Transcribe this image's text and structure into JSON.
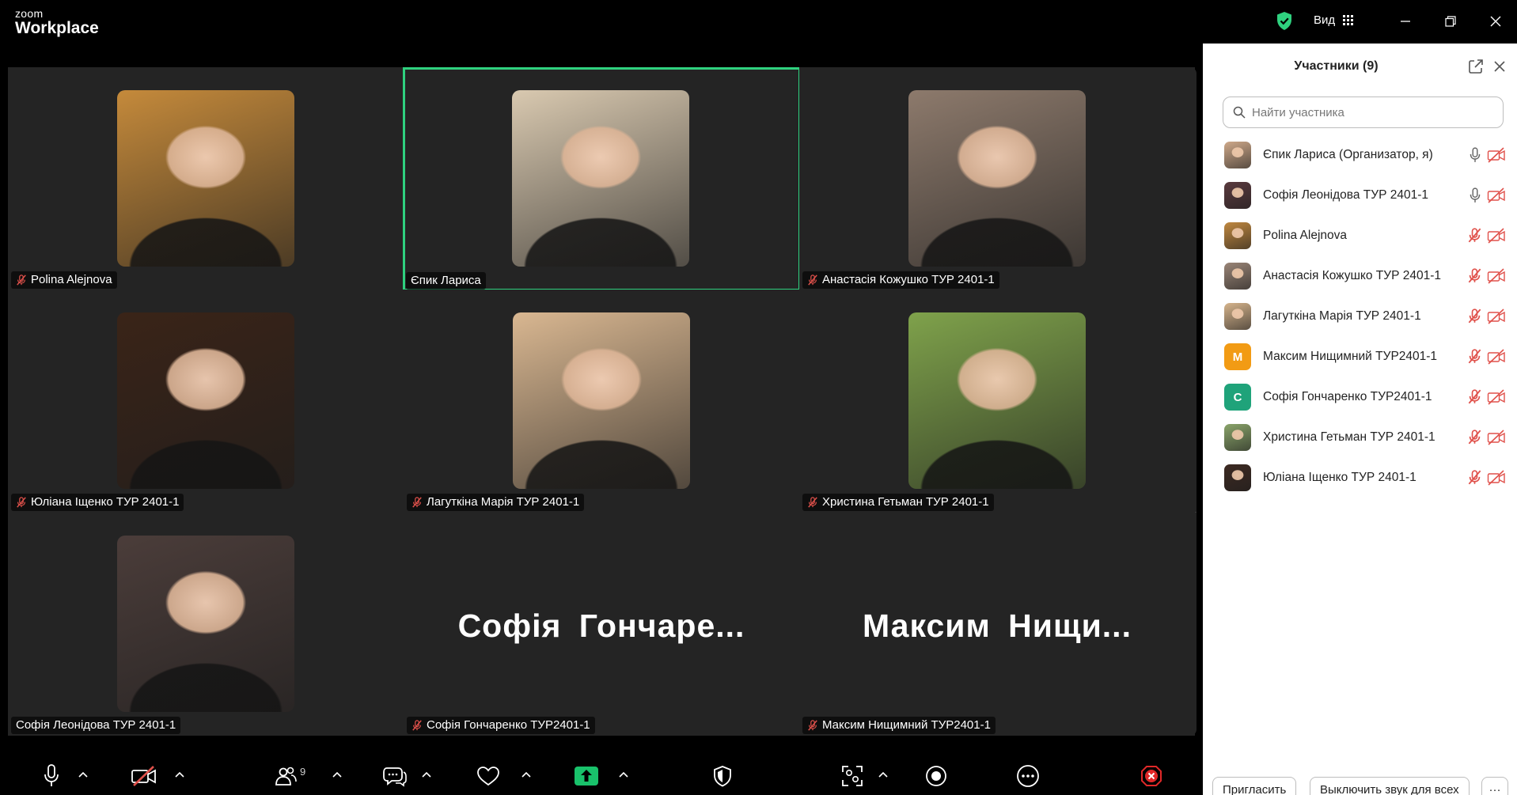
{
  "window": {
    "logo_small": "zoom",
    "logo_big": "Workplace",
    "view_label": "Вид"
  },
  "tiles": [
    {
      "name": "Polina Alejnova",
      "muted": true,
      "bg": "#c58a3b"
    },
    {
      "name": "Єпик Лариса",
      "muted": false,
      "active": true,
      "bg": "#d9c9b0"
    },
    {
      "name": "Анастасія Кожушко ТУР 2401-1",
      "muted": true,
      "bg": "#8d7a6c"
    },
    {
      "name": "Юліана Іщенко ТУР 2401-1",
      "muted": true,
      "bg": "#3a2418"
    },
    {
      "name": "Лагуткіна Марія ТУР 2401-1",
      "muted": true,
      "bg": "#d9b791"
    },
    {
      "name": "Христина Гетьман ТУР 2401-1",
      "muted": true,
      "bg": "#7fa24b"
    },
    {
      "name": "Софія Леонідова ТУР 2401-1",
      "muted": false,
      "bg": "#4b3d3a"
    },
    {
      "name": "Софія Гончаренко ТУР2401-1",
      "muted": true,
      "big_name": "Софія  Гончаре..."
    },
    {
      "name": "Максим Нищимний ТУР2401-1",
      "muted": true,
      "big_name": "Максим  Нищи..."
    }
  ],
  "toolbar": {
    "participants_count": "9"
  },
  "panel": {
    "title": "Участники (9)",
    "search_placeholder": "Найти участника",
    "participants": [
      {
        "name": "Єпик Лариса (Организатор, я)",
        "mic_on": true,
        "avatar_color": "#cfa98a",
        "initial": ""
      },
      {
        "name": "Софія Леонідова ТУР 2401-1",
        "mic_on": true,
        "avatar_color": "#5a3a3e",
        "initial": ""
      },
      {
        "name": "Polina Alejnova",
        "mic_on": false,
        "avatar_color": "#c08840",
        "initial": ""
      },
      {
        "name": "Анастасія Кожушко ТУР 2401-1",
        "mic_on": false,
        "avatar_color": "#9a8577",
        "initial": ""
      },
      {
        "name": "Лагуткіна Марія ТУР 2401-1",
        "mic_on": false,
        "avatar_color": "#d6b48c",
        "initial": ""
      },
      {
        "name": "Максим Нищимний ТУР2401-1",
        "mic_on": false,
        "avatar_color": "#f29b14",
        "initial": "M"
      },
      {
        "name": "Софія Гончаренко ТУР2401-1",
        "mic_on": false,
        "avatar_color": "#1fa37a",
        "initial": "C"
      },
      {
        "name": "Христина Гетьман ТУР 2401-1",
        "mic_on": false,
        "avatar_color": "#8aa46a",
        "initial": ""
      },
      {
        "name": "Юліана Іщенко ТУР 2401-1",
        "mic_on": false,
        "avatar_color": "#3d2a22",
        "initial": ""
      }
    ],
    "invite_label": "Пригласить",
    "mute_all_label": "Выключить звук для всех",
    "more_label": "···"
  },
  "colors": {
    "accent_green": "#2fd17f",
    "muted_red": "#e0514b",
    "share_green": "#19c26b",
    "end_red": "#e02828"
  }
}
